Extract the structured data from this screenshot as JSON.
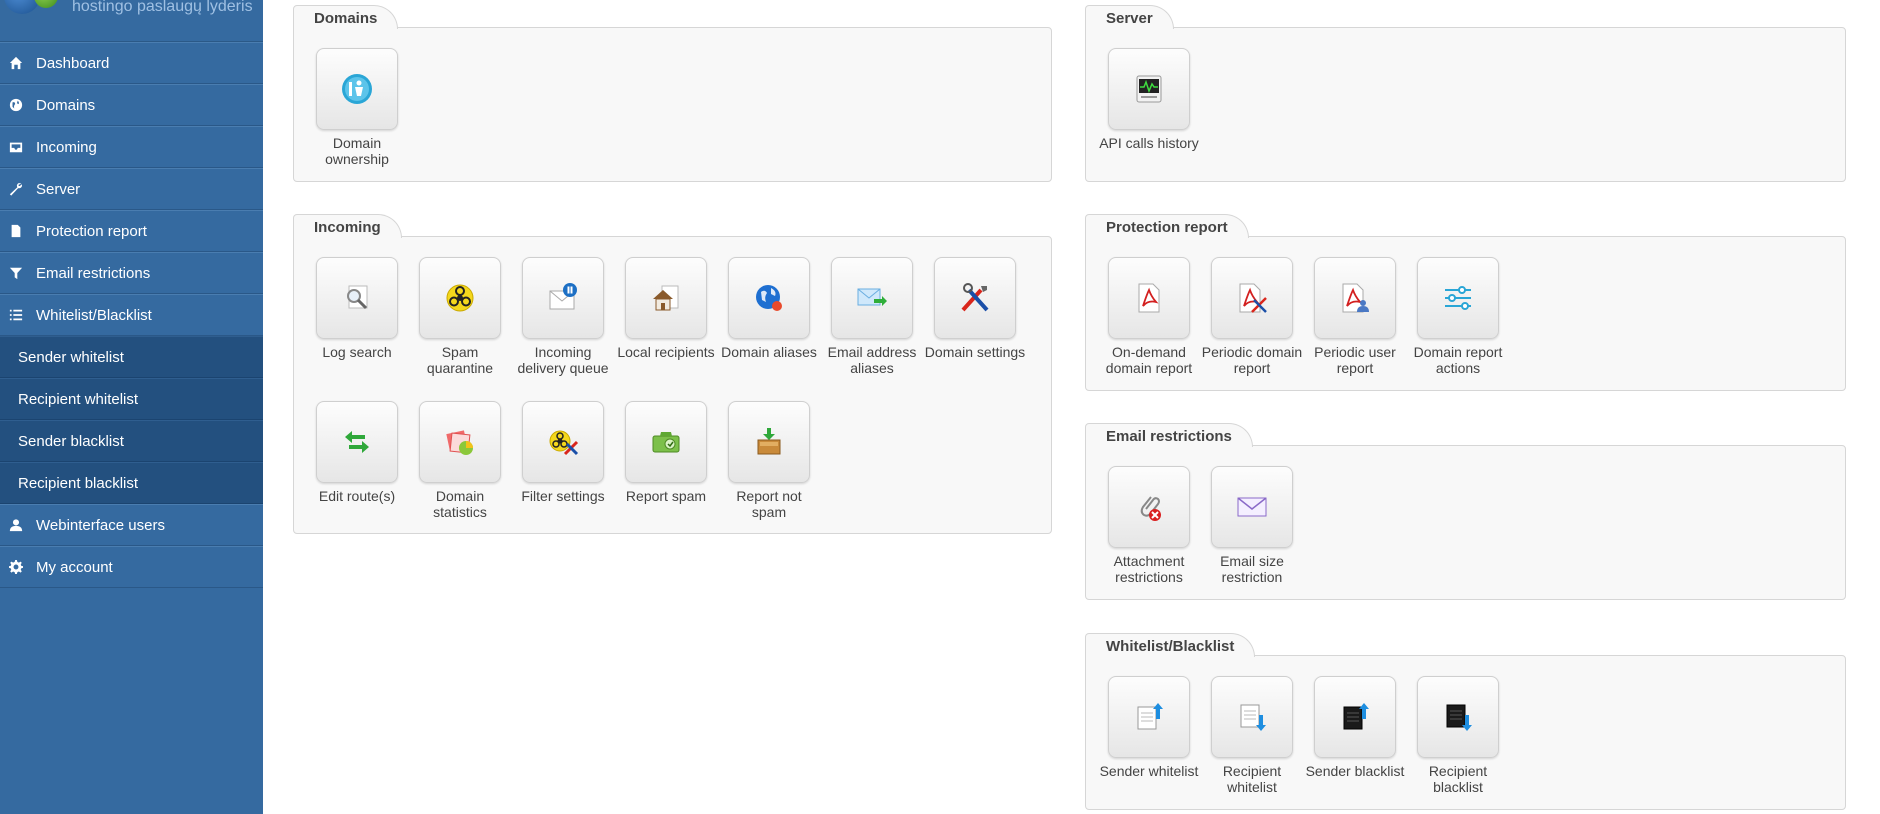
{
  "brand": {
    "tagline": "hostingo paslaugų lyderis"
  },
  "sidebar": {
    "items": [
      {
        "label": "Dashboard",
        "icon": "home-icon"
      },
      {
        "label": "Domains",
        "icon": "globe-icon"
      },
      {
        "label": "Incoming",
        "icon": "inbox-icon"
      },
      {
        "label": "Server",
        "icon": "wrench-icon"
      },
      {
        "label": "Protection report",
        "icon": "file-icon"
      },
      {
        "label": "Email restrictions",
        "icon": "filter-icon"
      },
      {
        "label": "Whitelist/Blacklist",
        "icon": "list-icon"
      }
    ],
    "subitems": [
      {
        "label": "Sender whitelist"
      },
      {
        "label": "Recipient whitelist"
      },
      {
        "label": "Sender blacklist"
      },
      {
        "label": "Recipient blacklist"
      }
    ],
    "bottom_items": [
      {
        "label": "Webinterface users",
        "icon": "user-icon"
      },
      {
        "label": "My account",
        "icon": "gear-icon"
      }
    ]
  },
  "panels": {
    "domains": {
      "title": "Domains",
      "tiles": [
        {
          "label": "Domain ownership",
          "icon": "domain-ownership-icon"
        }
      ]
    },
    "server": {
      "title": "Server",
      "tiles": [
        {
          "label": "API calls history",
          "icon": "api-history-icon"
        }
      ]
    },
    "incoming": {
      "title": "Incoming",
      "tiles": [
        {
          "label": "Log search",
          "icon": "magnifier-icon"
        },
        {
          "label": "Spam quarantine",
          "icon": "biohazard-icon"
        },
        {
          "label": "Incoming delivery queue",
          "icon": "mail-queue-icon"
        },
        {
          "label": "Local recipients",
          "icon": "house-icon"
        },
        {
          "label": "Domain aliases",
          "icon": "globe-icon"
        },
        {
          "label": "Email address aliases",
          "icon": "mail-arrow-icon"
        },
        {
          "label": "Domain settings",
          "icon": "tools-icon"
        },
        {
          "label": "Edit route(s)",
          "icon": "route-arrows-icon"
        },
        {
          "label": "Domain statistics",
          "icon": "statistics-icon"
        },
        {
          "label": "Filter settings",
          "icon": "filter-tools-icon"
        },
        {
          "label": "Report spam",
          "icon": "report-spam-icon"
        },
        {
          "label": "Report not spam",
          "icon": "report-not-spam-icon"
        }
      ]
    },
    "protection_report": {
      "title": "Protection report",
      "tiles": [
        {
          "label": "On-demand domain report",
          "icon": "pdf-icon"
        },
        {
          "label": "Periodic domain report",
          "icon": "pdf-tools-icon"
        },
        {
          "label": "Periodic user report",
          "icon": "pdf-user-icon"
        },
        {
          "label": "Domain report actions",
          "icon": "sliders-icon"
        }
      ]
    },
    "email_restrictions": {
      "title": "Email restrictions",
      "tiles": [
        {
          "label": "Attachment restrictions",
          "icon": "attachment-blocked-icon"
        },
        {
          "label": "Email size restriction",
          "icon": "envelope-icon"
        }
      ]
    },
    "whitelist_blacklist": {
      "title": "Whitelist/Blacklist",
      "tiles": [
        {
          "label": "Sender whitelist",
          "icon": "doc-up-icon"
        },
        {
          "label": "Recipient whitelist",
          "icon": "doc-down-icon"
        },
        {
          "label": "Sender blacklist",
          "icon": "black-doc-up-icon"
        },
        {
          "label": "Recipient blacklist",
          "icon": "black-doc-down-icon"
        }
      ]
    }
  }
}
